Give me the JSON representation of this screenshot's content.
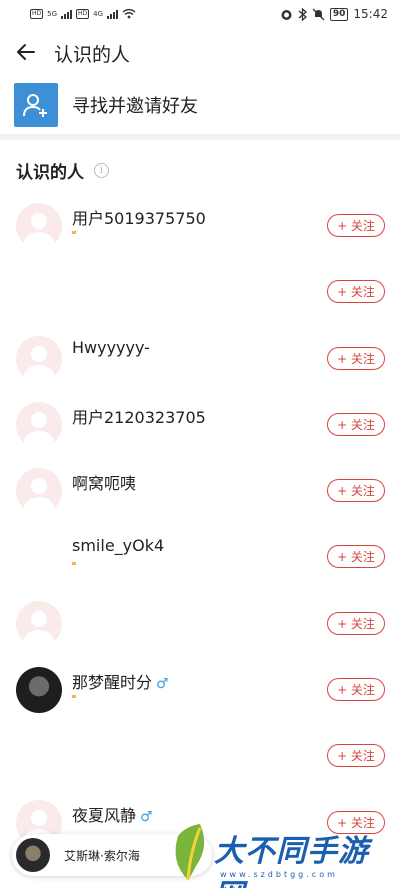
{
  "status_bar": {
    "time": "15:42",
    "battery": "90",
    "left_tags": [
      "HD",
      "HD"
    ],
    "net_labels": [
      "5G",
      "4G"
    ]
  },
  "header": {
    "title": "认识的人"
  },
  "invite": {
    "label": "寻找并邀请好友"
  },
  "section": {
    "title": "认识的人"
  },
  "follow_label": "+ 关注",
  "people": [
    {
      "name": "用户5019375750",
      "avatar": "default"
    },
    {
      "name": "",
      "avatar": "blank"
    },
    {
      "name": "Hwyyyyy-",
      "avatar": "default"
    },
    {
      "name": "用户2120323705",
      "avatar": "default"
    },
    {
      "name": "啊窝呃咦",
      "avatar": "default"
    },
    {
      "name": "smile_yOk4",
      "avatar": "blank"
    },
    {
      "name": "",
      "avatar": "default"
    },
    {
      "name": "那梦醒时分",
      "avatar": "photo",
      "gender": "♂"
    },
    {
      "name": "",
      "avatar": "blank"
    },
    {
      "name": "夜夏风静",
      "avatar": "default",
      "gender": "♂"
    }
  ],
  "bottom_chip": {
    "text": "艾斯琳·索尔海"
  },
  "watermark": {
    "text": "大不同手游网",
    "url": "www.szdbtgg.com"
  },
  "colors": {
    "accent_red": "#d8453e",
    "invite_blue": "#3d8fd6",
    "gender_blue": "#3aa0e0"
  }
}
